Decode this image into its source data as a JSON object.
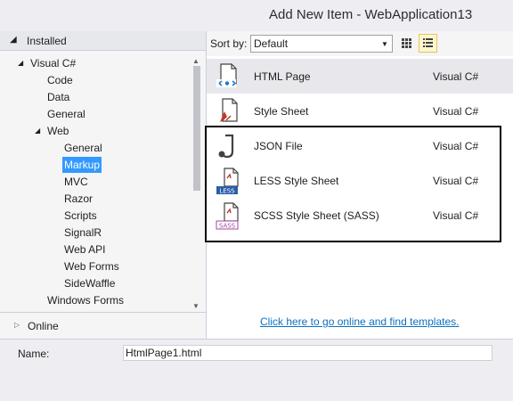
{
  "window": {
    "title": "Add New Item - WebApplication13"
  },
  "left_panel": {
    "installed_label": "Installed",
    "online_label": "Online",
    "tree": [
      {
        "id": "visual-csharp",
        "label": "Visual C#",
        "depth": 0,
        "toggle": "▲"
      },
      {
        "id": "code",
        "label": "Code",
        "depth": 1
      },
      {
        "id": "data",
        "label": "Data",
        "depth": 1
      },
      {
        "id": "general",
        "label": "General",
        "depth": 1
      },
      {
        "id": "web",
        "label": "Web",
        "depth": 1,
        "toggle": "▲"
      },
      {
        "id": "web-general",
        "label": "General",
        "depth": 2
      },
      {
        "id": "markup",
        "label": "Markup",
        "depth": 2,
        "selected": true
      },
      {
        "id": "mvc",
        "label": "MVC",
        "depth": 2
      },
      {
        "id": "razor",
        "label": "Razor",
        "depth": 2
      },
      {
        "id": "scripts",
        "label": "Scripts",
        "depth": 2
      },
      {
        "id": "signalr",
        "label": "SignalR",
        "depth": 2
      },
      {
        "id": "web-api",
        "label": "Web API",
        "depth": 2
      },
      {
        "id": "web-forms",
        "label": "Web Forms",
        "depth": 2
      },
      {
        "id": "sidewaffle",
        "label": "SideWaffle",
        "depth": 2
      },
      {
        "id": "windows-forms",
        "label": "Windows Forms",
        "depth": 1
      }
    ]
  },
  "toolbar": {
    "sort_label": "Sort by:",
    "sort_value": "Default",
    "grid_view_icon": "grid-view-icon",
    "list_view_icon": "list-view-icon"
  },
  "templates": [
    {
      "name": "HTML Page",
      "type": "Visual C#",
      "icon": "html-page-icon",
      "selected": true
    },
    {
      "name": "Style Sheet",
      "type": "Visual C#",
      "icon": "style-sheet-icon"
    },
    {
      "name": "JSON File",
      "type": "Visual C#",
      "icon": "json-file-icon"
    },
    {
      "name": "LESS Style Sheet",
      "type": "Visual C#",
      "icon": "less-file-icon",
      "badge": "LESS"
    },
    {
      "name": "SCSS Style Sheet (SASS)",
      "type": "Visual C#",
      "icon": "scss-file-icon",
      "badge": "SASS"
    }
  ],
  "online_link": "Click here to go online and find templates.",
  "bottom": {
    "name_label": "Name:",
    "name_value": "HtmlPage1.html"
  },
  "colors": {
    "selection": "#3399ff",
    "link": "#0e70c0",
    "accent_blue": "#1f7ac2",
    "less_blue": "#2a5ea8",
    "sass_purple": "#a04aa0",
    "css_red": "#c0392b"
  }
}
